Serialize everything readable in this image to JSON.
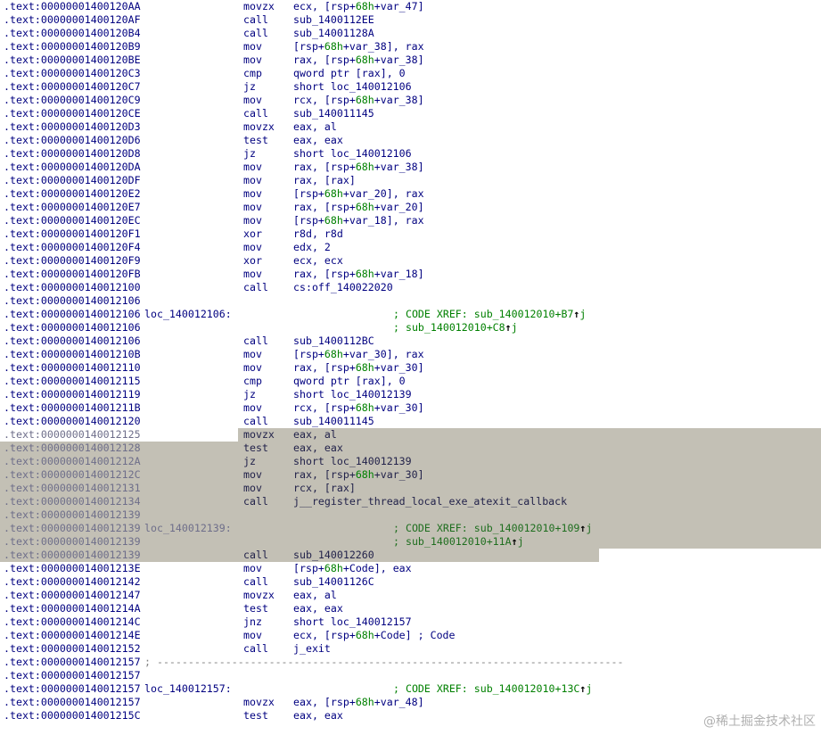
{
  "listing": [
    {
      "addr": ".text:00000001400120AA",
      "mnem": "movzx",
      "ops": "ecx, [rsp+68h+var_47]"
    },
    {
      "addr": ".text:00000001400120AF",
      "mnem": "call",
      "ops": "sub_1400112EE"
    },
    {
      "addr": ".text:00000001400120B4",
      "mnem": "call",
      "ops": "sub_14001128A"
    },
    {
      "addr": ".text:00000001400120B9",
      "mnem": "mov",
      "ops": "[rsp+68h+var_38], rax"
    },
    {
      "addr": ".text:00000001400120BE",
      "mnem": "mov",
      "ops": "rax, [rsp+68h+var_38]"
    },
    {
      "addr": ".text:00000001400120C3",
      "mnem": "cmp",
      "ops": "qword ptr [rax], 0"
    },
    {
      "addr": ".text:00000001400120C7",
      "mnem": "jz",
      "ops": "short loc_140012106"
    },
    {
      "addr": ".text:00000001400120C9",
      "mnem": "mov",
      "ops": "rcx, [rsp+68h+var_38]"
    },
    {
      "addr": ".text:00000001400120CE",
      "mnem": "call",
      "ops": "sub_140011145"
    },
    {
      "addr": ".text:00000001400120D3",
      "mnem": "movzx",
      "ops": "eax, al"
    },
    {
      "addr": ".text:00000001400120D6",
      "mnem": "test",
      "ops": "eax, eax"
    },
    {
      "addr": ".text:00000001400120D8",
      "mnem": "jz",
      "ops": "short loc_140012106"
    },
    {
      "addr": ".text:00000001400120DA",
      "mnem": "mov",
      "ops": "rax, [rsp+68h+var_38]"
    },
    {
      "addr": ".text:00000001400120DF",
      "mnem": "mov",
      "ops": "rax, [rax]"
    },
    {
      "addr": ".text:00000001400120E2",
      "mnem": "mov",
      "ops": "[rsp+68h+var_20], rax"
    },
    {
      "addr": ".text:00000001400120E7",
      "mnem": "mov",
      "ops": "rax, [rsp+68h+var_20]"
    },
    {
      "addr": ".text:00000001400120EC",
      "mnem": "mov",
      "ops": "[rsp+68h+var_18], rax"
    },
    {
      "addr": ".text:00000001400120F1",
      "mnem": "xor",
      "ops": "r8d, r8d"
    },
    {
      "addr": ".text:00000001400120F4",
      "mnem": "mov",
      "ops": "edx, 2"
    },
    {
      "addr": ".text:00000001400120F9",
      "mnem": "xor",
      "ops": "ecx, ecx"
    },
    {
      "addr": ".text:00000001400120FB",
      "mnem": "mov",
      "ops": "rax, [rsp+68h+var_18]"
    },
    {
      "addr": ".text:0000000140012100",
      "mnem": "call",
      "ops": "cs:off_140022020"
    },
    {
      "addr": ".text:0000000140012106"
    },
    {
      "addr": ".text:0000000140012106",
      "label": "loc_140012106:",
      "comment": "; CODE XREF: sub_140012010+B7",
      "arrow": "↑",
      "suffix": "j"
    },
    {
      "addr": ".text:0000000140012106",
      "comment": "; sub_140012010+C8",
      "arrow": "↑",
      "suffix": "j"
    },
    {
      "addr": ".text:0000000140012106",
      "mnem": "call",
      "ops": "sub_1400112BC"
    },
    {
      "addr": ".text:000000014001210B",
      "mnem": "mov",
      "ops": "[rsp+68h+var_30], rax"
    },
    {
      "addr": ".text:0000000140012110",
      "mnem": "mov",
      "ops": "rax, [rsp+68h+var_30]"
    },
    {
      "addr": ".text:0000000140012115",
      "mnem": "cmp",
      "ops": "qword ptr [rax], 0"
    },
    {
      "addr": ".text:0000000140012119",
      "mnem": "jz",
      "ops": "short loc_140012139"
    },
    {
      "addr": ".text:000000014001211B",
      "mnem": "mov",
      "ops": "rcx, [rsp+68h+var_30]"
    },
    {
      "addr": ".text:0000000140012120",
      "mnem": "call",
      "ops": "sub_140011145"
    },
    {
      "addr": ".text:0000000140012125",
      "mnem": "movzx",
      "ops": "eax, al",
      "sel": "full"
    },
    {
      "addr": ".text:0000000140012128",
      "mnem": "test",
      "ops": "eax, eax",
      "sel": "mid"
    },
    {
      "addr": ".text:000000014001212A",
      "mnem": "jz",
      "ops": "short loc_140012139",
      "sel": "mid"
    },
    {
      "addr": ".text:000000014001212C",
      "mnem": "mov",
      "ops": "rax, [rsp+68h+var_30]",
      "sel": "mid"
    },
    {
      "addr": ".text:0000000140012131",
      "mnem": "mov",
      "ops": "rcx, [rax]",
      "sel": "mid"
    },
    {
      "addr": ".text:0000000140012134",
      "mnem": "call",
      "ops": "j__register_thread_local_exe_atexit_callback",
      "sel": "mid"
    },
    {
      "addr": ".text:0000000140012139",
      "sel": "mid"
    },
    {
      "addr": ".text:0000000140012139",
      "label": "loc_140012139:",
      "comment": "; CODE XREF: sub_140012010+109",
      "arrow": "↑",
      "suffix": "j",
      "sel": "mid"
    },
    {
      "addr": ".text:0000000140012139",
      "comment": "; sub_140012010+11A",
      "arrow": "↑",
      "suffix": "j",
      "sel": "mid"
    },
    {
      "addr": ".text:0000000140012139",
      "mnem": "call",
      "ops": "sub_140012260",
      "sel": "short"
    },
    {
      "addr": ".text:000000014001213E",
      "mnem": "mov",
      "ops": "[rsp+68h+Code], eax"
    },
    {
      "addr": ".text:0000000140012142",
      "mnem": "call",
      "ops": "sub_14001126C"
    },
    {
      "addr": ".text:0000000140012147",
      "mnem": "movzx",
      "ops": "eax, al"
    },
    {
      "addr": ".text:000000014001214A",
      "mnem": "test",
      "ops": "eax, eax"
    },
    {
      "addr": ".text:000000014001214C",
      "mnem": "jnz",
      "ops": "short loc_140012157"
    },
    {
      "addr": ".text:000000014001214E",
      "mnem": "mov",
      "ops": "ecx, [rsp+68h+Code] ; Code"
    },
    {
      "addr": ".text:0000000140012152",
      "mnem": "call",
      "ops": "j_exit"
    },
    {
      "addr": ".text:0000000140012157",
      "separator": "; ---------------------------------------------------------------------------"
    },
    {
      "addr": ".text:0000000140012157"
    },
    {
      "addr": ".text:0000000140012157",
      "label": "loc_140012157:",
      "comment": "; CODE XREF: sub_140012010+13C",
      "arrow": "↑",
      "suffix": "j"
    },
    {
      "addr": ".text:0000000140012157",
      "mnem": "movzx",
      "ops": "eax, [rsp+68h+var_48]"
    },
    {
      "addr": ".text:000000014001215C",
      "mnem": "test",
      "ops": "eax, eax"
    }
  ],
  "watermark": "@稀土掘金技术社区",
  "colors": {
    "address": "#000080",
    "comment": "#008000",
    "selection": "#c3c0b5",
    "separator": "#808080"
  }
}
